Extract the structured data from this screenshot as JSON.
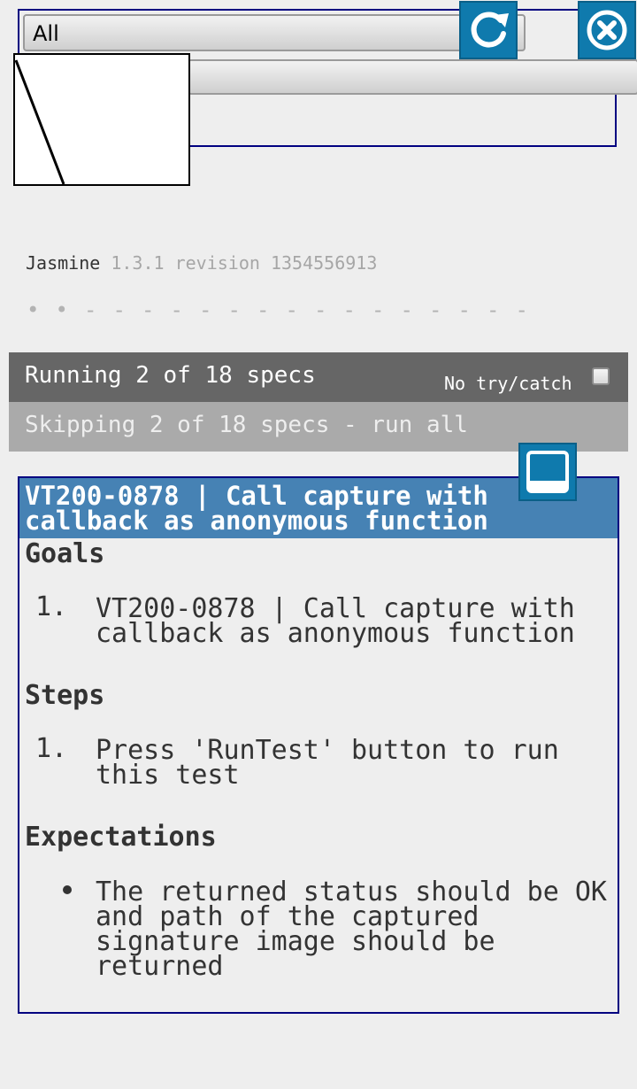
{
  "toolbar": {
    "select_value": "All",
    "refresh_icon": "refresh-icon",
    "close_icon": "close-icon"
  },
  "reporter": {
    "name": "Jasmine",
    "version": "1.3.1 revision 1354556913",
    "progress": "• • - - - - - - - - - - - - - - - -"
  },
  "alerts": {
    "running": "Running 2 of 18 specs",
    "no_try_catch_label": "No try/catch",
    "skipping": "Skipping 2 of 18 specs - run all"
  },
  "test": {
    "title": "VT200-0878 | Call capture with callback as anonymous function",
    "goals_heading": "Goals",
    "goals": [
      {
        "num": "1.",
        "text": "VT200-0878 | Call capture with callback as anonymous function"
      }
    ],
    "steps_heading": "Steps",
    "steps": [
      {
        "num": "1.",
        "text": "Press 'RunTest' button to run this test"
      }
    ],
    "expectations_heading": "Expectations",
    "expectations": [
      {
        "text": "The returned status should be OK and path of the captured signature image should be returned"
      }
    ],
    "minimize_icon": "minimize-icon"
  },
  "colors": {
    "accent": "#0f7aad",
    "header": "#4682b4",
    "running_bar": "#666666",
    "skipping_bar": "#aaaaaa",
    "frame_border": "#000080"
  }
}
